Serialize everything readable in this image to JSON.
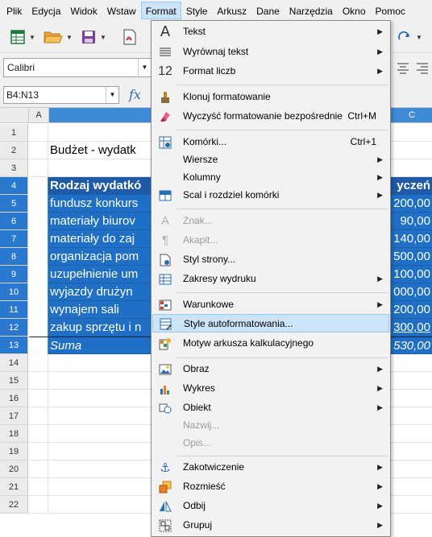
{
  "menubar": {
    "items": [
      "Plik",
      "Edycja",
      "Widok",
      "Wstaw",
      "Format",
      "Style",
      "Arkusz",
      "Dane",
      "Narzędzia",
      "Okno",
      "Pomoc"
    ],
    "active_index": 4
  },
  "toolbar": {
    "font_name": "Calibri",
    "icons": [
      "new-spreadsheet-icon",
      "open-folder-icon",
      "save-icon",
      "export-pdf-icon",
      "redo-icon",
      "align-center-icon",
      "align-right-icon"
    ]
  },
  "formula_bar": {
    "name_box": "B4:N13",
    "fx_label": "fx"
  },
  "sheet": {
    "columns": [
      "A",
      "C"
    ],
    "row_numbers": [
      "1",
      "2",
      "3",
      "4",
      "5",
      "6",
      "7",
      "8",
      "9",
      "10",
      "11",
      "12",
      "13",
      "14",
      "15",
      "16",
      "17",
      "18",
      "19",
      "20",
      "21",
      "22"
    ],
    "title": "Budżet - wydatk",
    "header_b": "Rodzaj wydatkó",
    "header_c": "yczeń",
    "items": [
      {
        "b": "fundusz konkurs",
        "c": "200,00"
      },
      {
        "b": "materiały biurov",
        "c": "90,00"
      },
      {
        "b": "materiały do zaj",
        "c": "140,00"
      },
      {
        "b": "organizacja pom",
        "c": "500,00"
      },
      {
        "b": "uzupełnienie um",
        "c": "100,00"
      },
      {
        "b": "wyjazdy drużyn",
        "c": "000,00"
      },
      {
        "b": "wynajem sali",
        "c": "200,00"
      },
      {
        "b": "zakup sprzętu i n",
        "c": "300,00"
      }
    ],
    "sum_b": "Suma",
    "sum_c": "530,00",
    "colors": {
      "header_blue": "#1e5aa8",
      "row_blue": "#1e6fc5",
      "selection_header": "#3f8bd6"
    }
  },
  "format_menu": {
    "items": [
      {
        "label": "Tekst",
        "shortcut": "",
        "submenu": true,
        "disabled": false,
        "icon": "text-A-icon"
      },
      {
        "label": "Wyrównaj tekst",
        "shortcut": "",
        "submenu": true,
        "disabled": false,
        "icon": "align-lines-icon"
      },
      {
        "label": "Format liczb",
        "shortcut": "",
        "submenu": true,
        "disabled": false,
        "icon": "number-12-icon"
      },
      {
        "label": "Klonuj formatowanie",
        "shortcut": "",
        "submenu": false,
        "disabled": false,
        "icon": "paintbrush-icon"
      },
      {
        "label": "Wyczyść formatowanie bezpośrednie",
        "shortcut": "Ctrl+M",
        "submenu": false,
        "disabled": false,
        "icon": "eraser-icon"
      },
      {
        "label": "Komórki...",
        "shortcut": "Ctrl+1",
        "submenu": false,
        "disabled": false,
        "icon": "format-cells-icon"
      },
      {
        "label": "Wiersze",
        "shortcut": "",
        "submenu": true,
        "disabled": false,
        "icon": ""
      },
      {
        "label": "Kolumny",
        "shortcut": "",
        "submenu": true,
        "disabled": false,
        "icon": ""
      },
      {
        "label": "Scal i rozdziel komórki",
        "shortcut": "",
        "submenu": true,
        "disabled": false,
        "icon": "merge-cells-icon"
      },
      {
        "label": "Znak...",
        "shortcut": "",
        "submenu": false,
        "disabled": true,
        "icon": "character-icon"
      },
      {
        "label": "Akapit...",
        "shortcut": "",
        "submenu": false,
        "disabled": true,
        "icon": "paragraph-icon"
      },
      {
        "label": "Styl strony...",
        "shortcut": "",
        "submenu": false,
        "disabled": false,
        "icon": "page-style-icon"
      },
      {
        "label": "Zakresy wydruku",
        "shortcut": "",
        "submenu": true,
        "disabled": false,
        "icon": "print-range-icon"
      },
      {
        "label": "Warunkowe",
        "shortcut": "",
        "submenu": true,
        "disabled": false,
        "icon": "conditional-format-icon"
      },
      {
        "label": "Style autoformatowania...",
        "shortcut": "",
        "submenu": false,
        "disabled": false,
        "icon": "autoformat-icon"
      },
      {
        "label": "Motyw arkusza kalkulacyjnego",
        "shortcut": "",
        "submenu": false,
        "disabled": false,
        "icon": "theme-icon"
      },
      {
        "label": "Obraz",
        "shortcut": "",
        "submenu": true,
        "disabled": false,
        "icon": "image-icon"
      },
      {
        "label": "Wykres",
        "shortcut": "",
        "submenu": true,
        "disabled": false,
        "icon": "chart-icon"
      },
      {
        "label": "Obiekt",
        "shortcut": "",
        "submenu": true,
        "disabled": false,
        "icon": "object-icon"
      },
      {
        "label": "Nazwij...",
        "shortcut": "",
        "submenu": false,
        "disabled": true,
        "icon": ""
      },
      {
        "label": "Opis...",
        "shortcut": "",
        "submenu": false,
        "disabled": true,
        "icon": ""
      },
      {
        "label": "Zakotwiczenie",
        "shortcut": "",
        "submenu": true,
        "disabled": false,
        "icon": "anchor-icon"
      },
      {
        "label": "Rozmieść",
        "shortcut": "",
        "submenu": true,
        "disabled": false,
        "icon": "arrange-icon"
      },
      {
        "label": "Odbij",
        "shortcut": "",
        "submenu": true,
        "disabled": false,
        "icon": "flip-icon"
      },
      {
        "label": "Grupuj",
        "shortcut": "",
        "submenu": true,
        "disabled": false,
        "icon": "group-icon"
      }
    ],
    "highlighted": "Style autoformatowania..."
  }
}
